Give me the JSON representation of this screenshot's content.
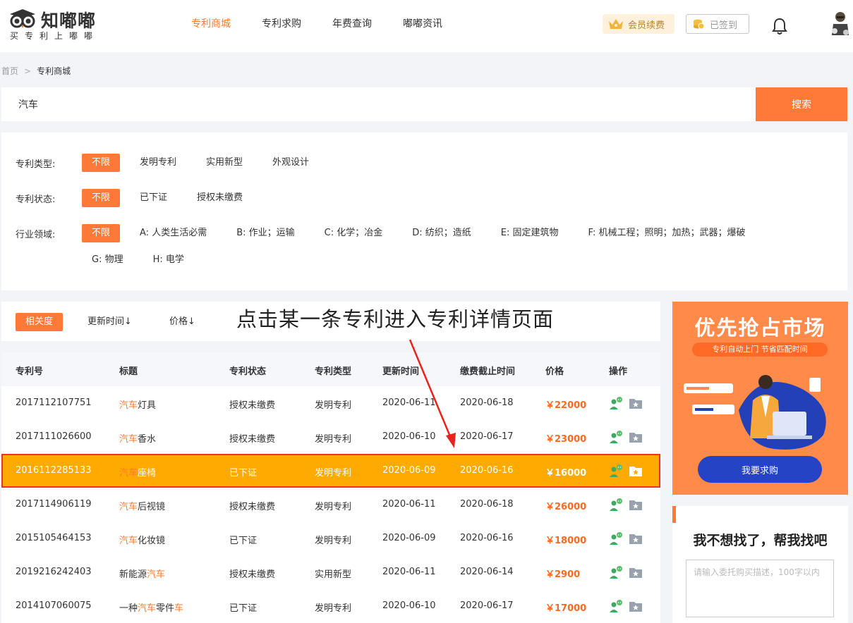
{
  "header": {
    "logo_text": "知嘟嘟",
    "logo_sub": "买专利上嘟嘟",
    "nav": [
      {
        "label": "专利商城",
        "active": true
      },
      {
        "label": "专利求购",
        "active": false
      },
      {
        "label": "年费查询",
        "active": false
      },
      {
        "label": "嘟嘟资讯",
        "active": false
      }
    ],
    "vip_label": "会员续费",
    "sign_label": "已签到"
  },
  "breadcrumb": {
    "home": "首页",
    "sep": ">",
    "current": "专利商城"
  },
  "search": {
    "value": "汽车",
    "button": "搜索"
  },
  "filters": {
    "type": {
      "label": "专利类型:",
      "options": [
        "不限",
        "发明专利",
        "实用新型",
        "外观设计"
      ]
    },
    "status": {
      "label": "专利状态:",
      "options": [
        "不限",
        "已下证",
        "授权未缴费"
      ]
    },
    "industry": {
      "label": "行业领域:",
      "options": [
        "不限",
        "A: 人类生活必需",
        "B: 作业；运输",
        "C: 化学；冶金",
        "D: 纺织；造纸",
        "E: 固定建筑物",
        "F: 机械工程；照明；加热；武器；爆破",
        "G: 物理",
        "H: 电学"
      ]
    }
  },
  "sort": {
    "items": [
      "相关度",
      "更新时间↓",
      "价格↓"
    ]
  },
  "annotation": "点击某一条专利进入专利详情页面",
  "table": {
    "headers": [
      "专利号",
      "标题",
      "专利状态",
      "专利类型",
      "更新时间",
      "缴费截止时间",
      "价格",
      "操作"
    ],
    "rows": [
      {
        "no": "2017112107751",
        "t1": "",
        "kw": "汽车",
        "t2": "灯具",
        "t3": "",
        "status": "授权未缴费",
        "type": "发明专利",
        "update": "2020-06-11",
        "deadline": "2020-06-18",
        "price": "￥22000"
      },
      {
        "no": "2017111026600",
        "t1": "",
        "kw": "汽车",
        "t2": "香水",
        "t3": "",
        "status": "授权未缴费",
        "type": "发明专利",
        "update": "2020-06-10",
        "deadline": "2020-06-17",
        "price": "￥23000"
      },
      {
        "no": "2016112285133",
        "t1": "",
        "kw": "汽车",
        "t2": "座椅",
        "t3": "",
        "status": "已下证",
        "type": "发明专利",
        "update": "2020-06-09",
        "deadline": "2020-06-16",
        "price": "￥16000"
      },
      {
        "no": "2017114906119",
        "t1": "",
        "kw": "汽车",
        "t2": "后视镜",
        "t3": "",
        "status": "授权未缴费",
        "type": "发明专利",
        "update": "2020-06-11",
        "deadline": "2020-06-18",
        "price": "￥26000"
      },
      {
        "no": "2015105464153",
        "t1": "",
        "kw": "汽车",
        "t2": "化妆镜",
        "t3": "",
        "status": "已下证",
        "type": "发明专利",
        "update": "2020-06-09",
        "deadline": "2020-06-16",
        "price": "￥18000"
      },
      {
        "no": "2019216242403",
        "t1": "新能源",
        "kw": "汽车",
        "t2": "",
        "t3": "",
        "status": "授权未缴费",
        "type": "实用新型",
        "update": "2020-06-11",
        "deadline": "2020-06-14",
        "price": "￥2900"
      },
      {
        "no": "2014107060075",
        "t1": "一种",
        "kw": "汽车",
        "t2": "零件",
        "t3": "车",
        "status": "已下证",
        "type": "发明专利",
        "update": "2020-06-10",
        "deadline": "2020-06-17",
        "price": "￥17000"
      }
    ]
  },
  "banner": {
    "title": "优先抢占市场",
    "subtitle": "专利自动上门 节省匹配时间",
    "button": "我要求购"
  },
  "help": {
    "title": "我不想找了，帮我找吧",
    "placeholder": "请输入委托购买描述，100字以内"
  },
  "colors": {
    "accent": "#ff7a38",
    "highlight_row": "#ffaa00",
    "banner_bg": "#ff8a4a",
    "banner_button": "#2443c5"
  }
}
